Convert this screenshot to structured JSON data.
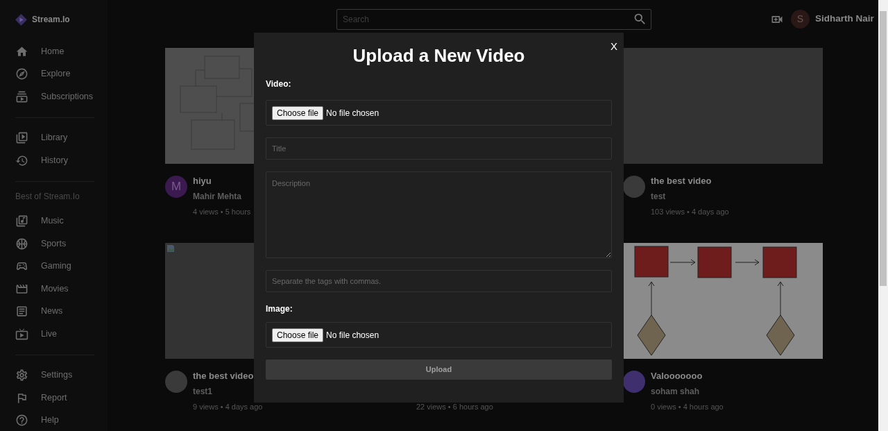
{
  "brand": {
    "name": "Stream.Io"
  },
  "sidebar": {
    "sections": [
      {
        "items": [
          {
            "label": "Home"
          },
          {
            "label": "Explore"
          },
          {
            "label": "Subscriptions"
          }
        ]
      },
      {
        "items": [
          {
            "label": "Library"
          },
          {
            "label": "History"
          }
        ]
      },
      {
        "heading": "Best of Stream.Io",
        "items": [
          {
            "label": "Music"
          },
          {
            "label": "Sports"
          },
          {
            "label": "Gaming"
          },
          {
            "label": "Movies"
          },
          {
            "label": "News"
          },
          {
            "label": "Live"
          }
        ]
      },
      {
        "items": [
          {
            "label": "Settings"
          },
          {
            "label": "Report"
          },
          {
            "label": "Help"
          }
        ]
      }
    ]
  },
  "search": {
    "placeholder": "Search"
  },
  "user": {
    "initial": "S",
    "name": "Sidharth Nair"
  },
  "video_columns": [
    {
      "videos": [
        {
          "thumbnail": {
            "kind": "diagram"
          },
          "avatar": {
            "initial": "M",
            "color": "#3b1a4f"
          },
          "title": "hiyu",
          "channel": "Mahir Mehta",
          "meta": "4 views • 5 hours"
        },
        {
          "thumbnail": {
            "kind": "broken"
          },
          "avatar": {
            "color": "#3a3a3a"
          },
          "title": "the best video",
          "channel": "test1",
          "meta": "9 views • 4 days ago"
        }
      ]
    },
    {
      "videos": [
        {
          "meta": "22 views • 6 hours ago"
        }
      ]
    },
    {
      "videos": [
        {
          "thumbnail": {
            "kind": "blank"
          },
          "avatar": {
            "color": "#3a3a3a"
          },
          "title": "the best video",
          "channel": "test",
          "meta": "103 views • 4 days ago"
        },
        {
          "thumbnail": {
            "kind": "flowchart"
          },
          "avatar": {
            "color": "#3f2f6e"
          },
          "title": "Valooooooo",
          "channel": "soham shah",
          "meta": "0 views • 4 hours ago"
        }
      ]
    }
  ],
  "upload_dialog": {
    "title": "Upload a New Video",
    "close": "X",
    "video_label": "Video:",
    "video_file": {
      "button": "Choose file",
      "status": "No file chosen"
    },
    "title_field": {
      "placeholder": "Title"
    },
    "description_field": {
      "placeholder": "Description"
    },
    "tags_field": {
      "placeholder": "Separate the tags with commas."
    },
    "image_label": "Image:",
    "image_file": {
      "button": "Choose file",
      "status": "No file chosen"
    },
    "submit": "Upload"
  }
}
